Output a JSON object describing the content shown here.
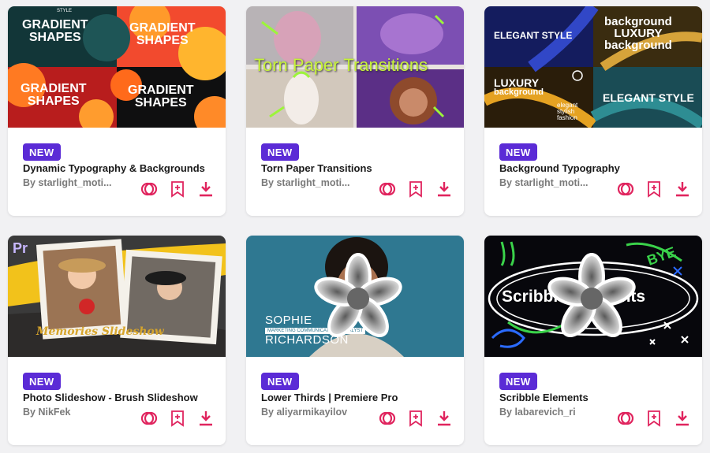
{
  "cards": [
    {
      "badge": "NEW",
      "title": "Dynamic Typography & Backgrounds",
      "author": "By starlight_moti...",
      "thumb": {
        "word_a": "GRADIENT",
        "word_b": "SHAPES",
        "tag": "STYLE"
      }
    },
    {
      "badge": "NEW",
      "title": "Torn Paper Transitions",
      "author": "By starlight_moti...",
      "thumb": {
        "headline": "Torn Paper Transitions"
      }
    },
    {
      "badge": "NEW",
      "title": "Background Typography",
      "author": "By starlight_moti...",
      "thumb": {
        "elegant": "ELEGANT STYLE",
        "luxury": "LUXURY",
        "background": "background",
        "fashion_a": "elegant",
        "fashion_b": "stylish",
        "fashion_c": "fashion"
      }
    },
    {
      "badge": "NEW",
      "title": "Photo Slideshow - Brush Slideshow",
      "author": "By NikFek",
      "thumb": {
        "app_logo": "Pr",
        "script": "Memories Slideshow"
      }
    },
    {
      "badge": "NEW",
      "title": "Lower Thirds | Premiere Pro",
      "author": "By aliyarmikayilov",
      "thumb": {
        "name_first": "SOPHIE",
        "name_last": "RICHARDSON",
        "role": "MARKETING COMMUNICATIONS ANALYST"
      }
    },
    {
      "badge": "NEW",
      "title": "Scribble Elements",
      "author": "By labarevich_ri",
      "thumb": {
        "word": "Scribble Elements",
        "bye": "BYE"
      }
    }
  ],
  "icons": {
    "similar": "overlap-circles-icon",
    "bookmark": "bookmark-plus-icon",
    "download": "download-icon"
  },
  "colors": {
    "accent": "#e0245e",
    "badge": "#5b2bd6"
  }
}
